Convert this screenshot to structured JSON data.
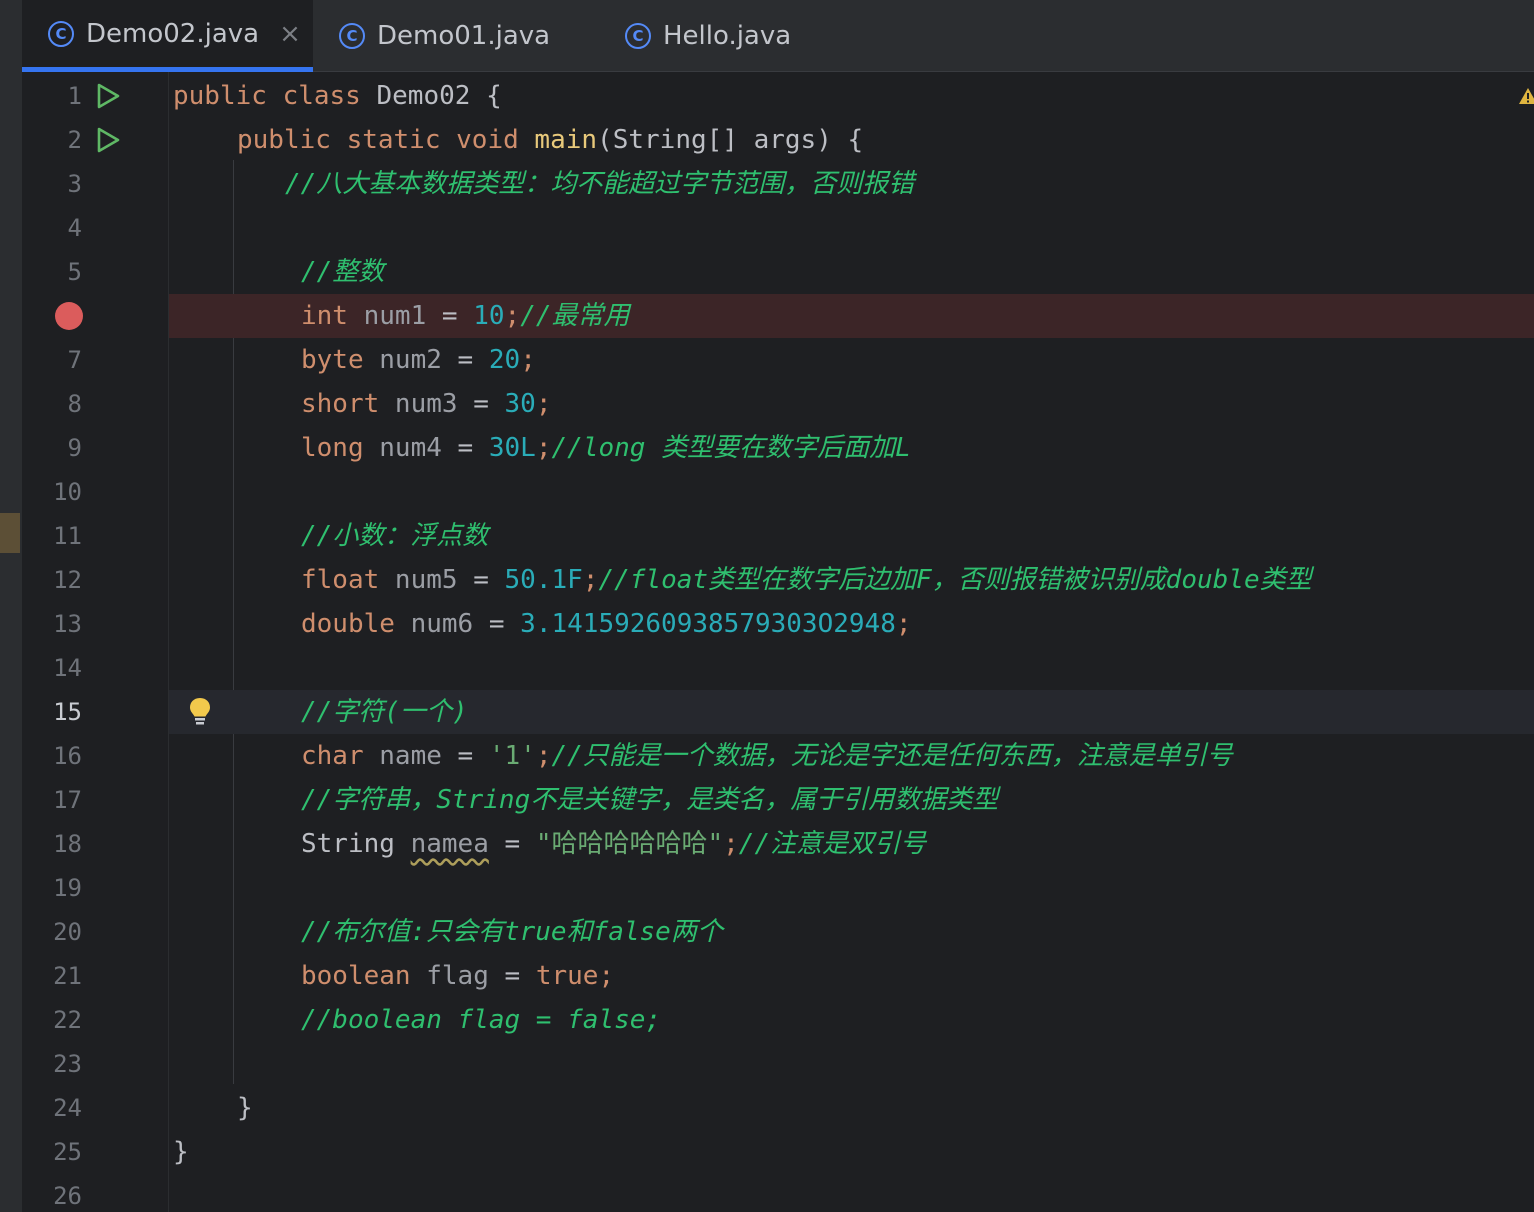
{
  "tabs": [
    {
      "label": "Demo02.java",
      "icon": "class-icon",
      "active": true,
      "close": "×"
    },
    {
      "label": "Demo01.java",
      "icon": "class-icon",
      "active": false
    },
    {
      "label": "Hello.java",
      "icon": "class-icon",
      "active": false
    }
  ],
  "tab_icon_glyph": "C",
  "colors": {
    "accent": "#3574f0",
    "keyword": "#cf8e6d",
    "comment": "#2fbf6f",
    "number": "#2aacb8",
    "string": "#6aab73",
    "breakpoint": "#db5c5c"
  },
  "editor": {
    "lines": [
      {
        "n": "1",
        "marker": "run",
        "tokens": [
          [
            "kw",
            "public class "
          ],
          [
            "pl",
            "Demo02 {"
          ]
        ]
      },
      {
        "n": "2",
        "marker": "run",
        "tokens": [
          [
            "kw",
            "public static void "
          ],
          [
            "fnb",
            "main"
          ],
          [
            "pl",
            "(String[] args) {"
          ]
        ]
      },
      {
        "n": "3",
        "tokens": [
          [
            "cm",
            "//八大基本数据类型：均不能超过字节范围，否则报错"
          ]
        ]
      },
      {
        "n": "4",
        "tokens": []
      },
      {
        "n": "5",
        "tokens": [
          [
            "cm",
            "//整数"
          ]
        ]
      },
      {
        "n": "",
        "marker": "breakpoint",
        "highlight": "breakpoint",
        "tokens": [
          [
            "kw",
            "int "
          ],
          [
            "vr",
            "num1"
          ],
          [
            "pl",
            " = "
          ],
          [
            "nm",
            "10"
          ],
          [
            "kw",
            ";"
          ],
          [
            "cm",
            "//最常用"
          ]
        ]
      },
      {
        "n": "7",
        "tokens": [
          [
            "kw",
            "byte "
          ],
          [
            "vr",
            "num2"
          ],
          [
            "pl",
            " = "
          ],
          [
            "nm",
            "20"
          ],
          [
            "kw",
            ";"
          ]
        ]
      },
      {
        "n": "8",
        "tokens": [
          [
            "kw",
            "short "
          ],
          [
            "vr",
            "num3"
          ],
          [
            "pl",
            " = "
          ],
          [
            "nm",
            "30"
          ],
          [
            "kw",
            ";"
          ]
        ]
      },
      {
        "n": "9",
        "tokens": [
          [
            "kw",
            "long "
          ],
          [
            "vr",
            "num4"
          ],
          [
            "pl",
            " = "
          ],
          [
            "nm",
            "30L"
          ],
          [
            "kw",
            ";"
          ],
          [
            "cm",
            "//long 类型要在数字后面加L"
          ]
        ]
      },
      {
        "n": "10",
        "tokens": []
      },
      {
        "n": "11",
        "tokens": [
          [
            "cm",
            "//小数：浮点数"
          ]
        ]
      },
      {
        "n": "12",
        "tokens": [
          [
            "kw",
            "float "
          ],
          [
            "vr",
            "num5"
          ],
          [
            "pl",
            " = "
          ],
          [
            "nm",
            "50.1F"
          ],
          [
            "kw",
            ";"
          ],
          [
            "cm",
            "//float类型在数字后边加F，否则报错被识别成double类型"
          ]
        ]
      },
      {
        "n": "13",
        "tokens": [
          [
            "kw",
            "double "
          ],
          [
            "vr",
            "num6"
          ],
          [
            "pl",
            " = "
          ],
          [
            "nm",
            "3.14159260938579303O2948"
          ],
          [
            "kw",
            ";"
          ]
        ]
      },
      {
        "n": "14",
        "tokens": []
      },
      {
        "n": "15",
        "marker": "bulb",
        "highlight": "current",
        "tokens": [
          [
            "cm",
            "//字符(一个)"
          ]
        ]
      },
      {
        "n": "16",
        "tokens": [
          [
            "kw",
            "char "
          ],
          [
            "vr",
            "name"
          ],
          [
            "pl",
            " = "
          ],
          [
            "st",
            "'1'"
          ],
          [
            "kw",
            ";"
          ],
          [
            "cm",
            "//只能是一个数据，无论是字还是任何东西，注意是单引号"
          ]
        ]
      },
      {
        "n": "17",
        "tokens": [
          [
            "cm",
            "//字符串，String不是关键字，是类名，属于引用数据类型"
          ]
        ]
      },
      {
        "n": "18",
        "tokens": [
          [
            "pl",
            "String "
          ],
          [
            "vrw",
            "namea"
          ],
          [
            "pl",
            " = "
          ],
          [
            "st",
            "\"哈哈哈哈哈哈\""
          ],
          [
            "kw",
            ";"
          ],
          [
            "cm",
            "//注意是双引号"
          ]
        ]
      },
      {
        "n": "19",
        "tokens": []
      },
      {
        "n": "20",
        "tokens": [
          [
            "cm",
            "//布尔值:只会有true和false两个"
          ]
        ]
      },
      {
        "n": "21",
        "tokens": [
          [
            "kw",
            "boolean "
          ],
          [
            "vr",
            "flag"
          ],
          [
            "pl",
            " = "
          ],
          [
            "kw",
            "true;"
          ]
        ]
      },
      {
        "n": "22",
        "tokens": [
          [
            "cm",
            "//boolean flag = false;"
          ]
        ]
      },
      {
        "n": "23",
        "tokens": []
      },
      {
        "n": "24",
        "tokens": [
          [
            "pl",
            "}"
          ]
        ]
      },
      {
        "n": "25",
        "tokens": [
          [
            "pl",
            "}"
          ]
        ]
      },
      {
        "n": "26",
        "tokens": []
      }
    ]
  }
}
